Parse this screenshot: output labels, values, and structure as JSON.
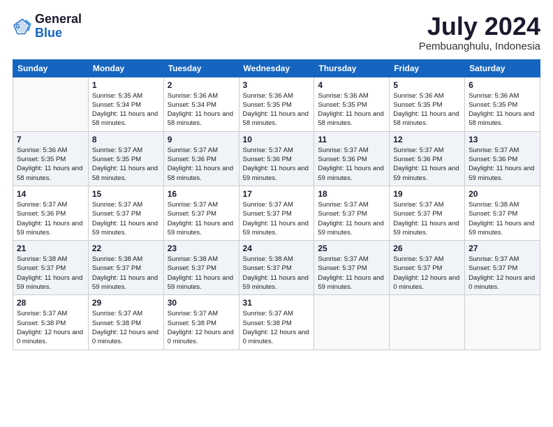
{
  "header": {
    "logo_general": "General",
    "logo_blue": "Blue",
    "month_year": "July 2024",
    "location": "Pembuanghulu, Indonesia"
  },
  "weekdays": [
    "Sunday",
    "Monday",
    "Tuesday",
    "Wednesday",
    "Thursday",
    "Friday",
    "Saturday"
  ],
  "weeks": [
    [
      {
        "num": "",
        "sunrise": "",
        "sunset": "",
        "daylight": "",
        "empty": true
      },
      {
        "num": "1",
        "sunrise": "Sunrise: 5:35 AM",
        "sunset": "Sunset: 5:34 PM",
        "daylight": "Daylight: 11 hours and 58 minutes.",
        "empty": false
      },
      {
        "num": "2",
        "sunrise": "Sunrise: 5:36 AM",
        "sunset": "Sunset: 5:34 PM",
        "daylight": "Daylight: 11 hours and 58 minutes.",
        "empty": false
      },
      {
        "num": "3",
        "sunrise": "Sunrise: 5:36 AM",
        "sunset": "Sunset: 5:35 PM",
        "daylight": "Daylight: 11 hours and 58 minutes.",
        "empty": false
      },
      {
        "num": "4",
        "sunrise": "Sunrise: 5:36 AM",
        "sunset": "Sunset: 5:35 PM",
        "daylight": "Daylight: 11 hours and 58 minutes.",
        "empty": false
      },
      {
        "num": "5",
        "sunrise": "Sunrise: 5:36 AM",
        "sunset": "Sunset: 5:35 PM",
        "daylight": "Daylight: 11 hours and 58 minutes.",
        "empty": false
      },
      {
        "num": "6",
        "sunrise": "Sunrise: 5:36 AM",
        "sunset": "Sunset: 5:35 PM",
        "daylight": "Daylight: 11 hours and 58 minutes.",
        "empty": false
      }
    ],
    [
      {
        "num": "7",
        "sunrise": "Sunrise: 5:36 AM",
        "sunset": "Sunset: 5:35 PM",
        "daylight": "Daylight: 11 hours and 58 minutes.",
        "empty": false
      },
      {
        "num": "8",
        "sunrise": "Sunrise: 5:37 AM",
        "sunset": "Sunset: 5:35 PM",
        "daylight": "Daylight: 11 hours and 58 minutes.",
        "empty": false
      },
      {
        "num": "9",
        "sunrise": "Sunrise: 5:37 AM",
        "sunset": "Sunset: 5:36 PM",
        "daylight": "Daylight: 11 hours and 58 minutes.",
        "empty": false
      },
      {
        "num": "10",
        "sunrise": "Sunrise: 5:37 AM",
        "sunset": "Sunset: 5:36 PM",
        "daylight": "Daylight: 11 hours and 59 minutes.",
        "empty": false
      },
      {
        "num": "11",
        "sunrise": "Sunrise: 5:37 AM",
        "sunset": "Sunset: 5:36 PM",
        "daylight": "Daylight: 11 hours and 59 minutes.",
        "empty": false
      },
      {
        "num": "12",
        "sunrise": "Sunrise: 5:37 AM",
        "sunset": "Sunset: 5:36 PM",
        "daylight": "Daylight: 11 hours and 59 minutes.",
        "empty": false
      },
      {
        "num": "13",
        "sunrise": "Sunrise: 5:37 AM",
        "sunset": "Sunset: 5:36 PM",
        "daylight": "Daylight: 11 hours and 59 minutes.",
        "empty": false
      }
    ],
    [
      {
        "num": "14",
        "sunrise": "Sunrise: 5:37 AM",
        "sunset": "Sunset: 5:36 PM",
        "daylight": "Daylight: 11 hours and 59 minutes.",
        "empty": false
      },
      {
        "num": "15",
        "sunrise": "Sunrise: 5:37 AM",
        "sunset": "Sunset: 5:37 PM",
        "daylight": "Daylight: 11 hours and 59 minutes.",
        "empty": false
      },
      {
        "num": "16",
        "sunrise": "Sunrise: 5:37 AM",
        "sunset": "Sunset: 5:37 PM",
        "daylight": "Daylight: 11 hours and 59 minutes.",
        "empty": false
      },
      {
        "num": "17",
        "sunrise": "Sunrise: 5:37 AM",
        "sunset": "Sunset: 5:37 PM",
        "daylight": "Daylight: 11 hours and 59 minutes.",
        "empty": false
      },
      {
        "num": "18",
        "sunrise": "Sunrise: 5:37 AM",
        "sunset": "Sunset: 5:37 PM",
        "daylight": "Daylight: 11 hours and 59 minutes.",
        "empty": false
      },
      {
        "num": "19",
        "sunrise": "Sunrise: 5:37 AM",
        "sunset": "Sunset: 5:37 PM",
        "daylight": "Daylight: 11 hours and 59 minutes.",
        "empty": false
      },
      {
        "num": "20",
        "sunrise": "Sunrise: 5:38 AM",
        "sunset": "Sunset: 5:37 PM",
        "daylight": "Daylight: 11 hours and 59 minutes.",
        "empty": false
      }
    ],
    [
      {
        "num": "21",
        "sunrise": "Sunrise: 5:38 AM",
        "sunset": "Sunset: 5:37 PM",
        "daylight": "Daylight: 11 hours and 59 minutes.",
        "empty": false
      },
      {
        "num": "22",
        "sunrise": "Sunrise: 5:38 AM",
        "sunset": "Sunset: 5:37 PM",
        "daylight": "Daylight: 11 hours and 59 minutes.",
        "empty": false
      },
      {
        "num": "23",
        "sunrise": "Sunrise: 5:38 AM",
        "sunset": "Sunset: 5:37 PM",
        "daylight": "Daylight: 11 hours and 59 minutes.",
        "empty": false
      },
      {
        "num": "24",
        "sunrise": "Sunrise: 5:38 AM",
        "sunset": "Sunset: 5:37 PM",
        "daylight": "Daylight: 11 hours and 59 minutes.",
        "empty": false
      },
      {
        "num": "25",
        "sunrise": "Sunrise: 5:37 AM",
        "sunset": "Sunset: 5:37 PM",
        "daylight": "Daylight: 11 hours and 59 minutes.",
        "empty": false
      },
      {
        "num": "26",
        "sunrise": "Sunrise: 5:37 AM",
        "sunset": "Sunset: 5:37 PM",
        "daylight": "Daylight: 12 hours and 0 minutes.",
        "empty": false
      },
      {
        "num": "27",
        "sunrise": "Sunrise: 5:37 AM",
        "sunset": "Sunset: 5:37 PM",
        "daylight": "Daylight: 12 hours and 0 minutes.",
        "empty": false
      }
    ],
    [
      {
        "num": "28",
        "sunrise": "Sunrise: 5:37 AM",
        "sunset": "Sunset: 5:38 PM",
        "daylight": "Daylight: 12 hours and 0 minutes.",
        "empty": false
      },
      {
        "num": "29",
        "sunrise": "Sunrise: 5:37 AM",
        "sunset": "Sunset: 5:38 PM",
        "daylight": "Daylight: 12 hours and 0 minutes.",
        "empty": false
      },
      {
        "num": "30",
        "sunrise": "Sunrise: 5:37 AM",
        "sunset": "Sunset: 5:38 PM",
        "daylight": "Daylight: 12 hours and 0 minutes.",
        "empty": false
      },
      {
        "num": "31",
        "sunrise": "Sunrise: 5:37 AM",
        "sunset": "Sunset: 5:38 PM",
        "daylight": "Daylight: 12 hours and 0 minutes.",
        "empty": false
      },
      {
        "num": "",
        "sunrise": "",
        "sunset": "",
        "daylight": "",
        "empty": true
      },
      {
        "num": "",
        "sunrise": "",
        "sunset": "",
        "daylight": "",
        "empty": true
      },
      {
        "num": "",
        "sunrise": "",
        "sunset": "",
        "daylight": "",
        "empty": true
      }
    ]
  ]
}
